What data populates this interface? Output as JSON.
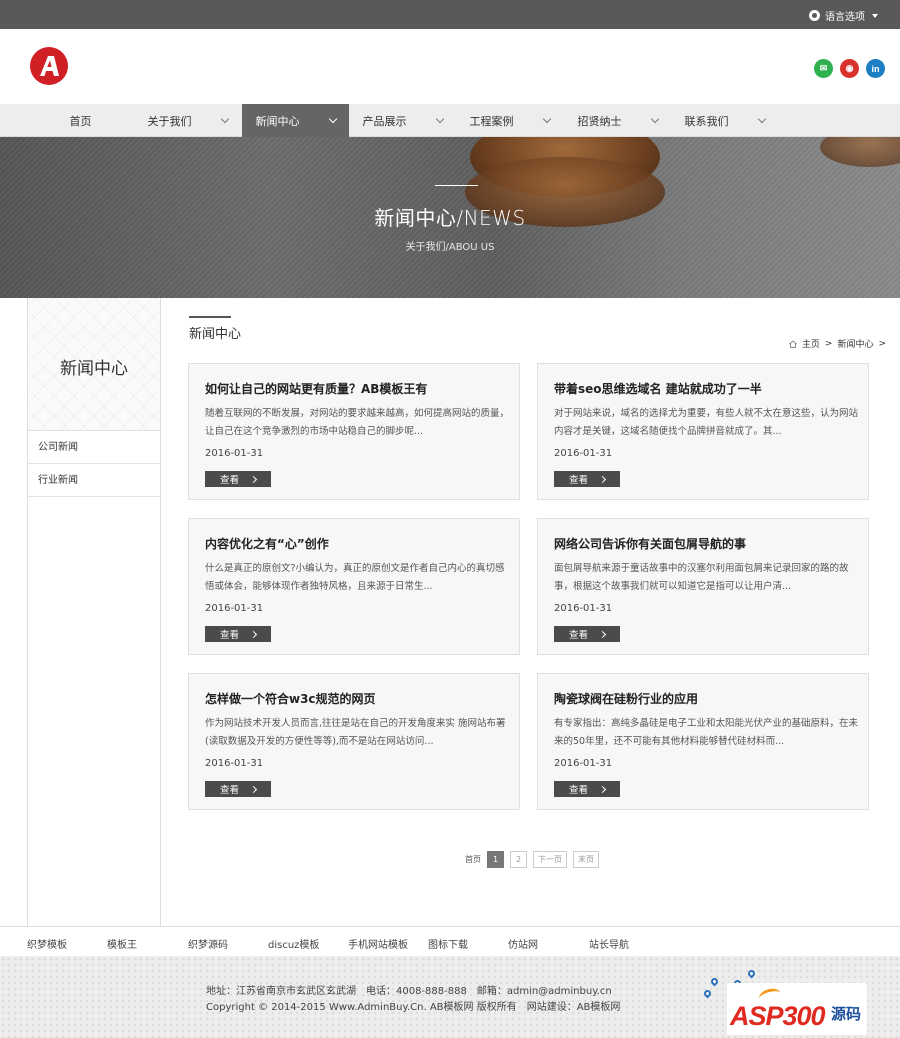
{
  "topbar": {
    "language_label": "语言选项"
  },
  "header": {
    "social": [
      "wechat",
      "weibo",
      "linkedin"
    ]
  },
  "nav": {
    "items": [
      {
        "label": "首页",
        "dropdown": false,
        "active": false
      },
      {
        "label": "关于我们",
        "dropdown": true,
        "active": false
      },
      {
        "label": "新闻中心",
        "dropdown": true,
        "active": true
      },
      {
        "label": "产品展示",
        "dropdown": true,
        "active": false
      },
      {
        "label": "工程案例",
        "dropdown": true,
        "active": false
      },
      {
        "label": "招贤纳士",
        "dropdown": true,
        "active": false
      },
      {
        "label": "联系我们",
        "dropdown": true,
        "active": false
      }
    ]
  },
  "banner": {
    "title": "新闻中心/NEWS",
    "subtitle": "关于我们/ABOU US"
  },
  "sidebar": {
    "title": "新闻中心",
    "links": [
      "公司新闻",
      "行业新闻"
    ]
  },
  "main": {
    "section_title": "新闻中心",
    "breadcrumb": {
      "home": "主页",
      "sep": ">",
      "current": "新闻中心",
      "sep2": ">"
    },
    "articles": [
      {
        "title": "如何让自己的网站更有质量？AB模板王有",
        "summary": "随着互联网的不断发展，对网站的要求越来越高，如何提高网站的质量，让自己在这个竞争激烈的市场中站稳自己的脚步呢...",
        "date": "2016-01-31",
        "button": "查看"
      },
      {
        "title": "带着seo思维选域名 建站就成功了一半",
        "summary": "对于网站来说，域名的选择尤为重要，有些人就不太在意这些，认为网站内容才是关键，这域名随便找个品牌拼音就成了。其...",
        "date": "2016-01-31",
        "button": "查看"
      },
      {
        "title": "内容优化之有“心”创作",
        "summary": "什么是真正的原创文?小编认为，真正的原创文是作者自己内心的真切感悟或体会，能够体现作者独特风格，且来源于日常生...",
        "date": "2016-01-31",
        "button": "查看"
      },
      {
        "title": "网络公司告诉你有关面包屑导航的事",
        "summary": "面包屑导航来源于童话故事中的汉塞尔利用面包屑来记录回家的路的故事，根据这个故事我们就可以知道它是指可以让用户清...",
        "date": "2016-01-31",
        "button": "查看"
      },
      {
        "title": "怎样做一个符合w3c规范的网页",
        "summary": "作为网站技术开发人员而言,往往是站在自己的开发角度来实 施网站布署(读取数据及开发的方便性等等),而不是站在网站访问...",
        "date": "2016-01-31",
        "button": "查看"
      },
      {
        "title": "陶瓷球阀在硅粉行业的应用",
        "summary": "有专家指出：高纯多晶硅是电子工业和太阳能光伏产业的基础原料，在未来的50年里，还不可能有其他材料能够替代硅材料而...",
        "date": "2016-01-31",
        "button": "查看"
      }
    ]
  },
  "pagination": {
    "first": "首页",
    "pages": [
      "1",
      "2"
    ],
    "current": "1",
    "next": "下一页",
    "last": "末页"
  },
  "footer_links": [
    "织梦模板",
    "模板王",
    "织梦源码",
    "discuz模板",
    "手机网站模板",
    "图标下载",
    "仿站网",
    "站长导航"
  ],
  "footer": {
    "address": "地址：江苏省南京市玄武区玄武湖　电话：4008-888-888　邮箱：admin@adminbuy.cn",
    "copyright": "Copyright © 2014-2015 Www.AdminBuy.Cn. AB模板网 版权所有　网站建设：AB模板网",
    "watermark": {
      "main": "ASP300",
      "suffix": "源码"
    }
  },
  "colors": {
    "topbar": "#5a5957",
    "nav_active": "#666563",
    "logo_red": "#d11f26",
    "button_dark": "#4b4b4b"
  }
}
